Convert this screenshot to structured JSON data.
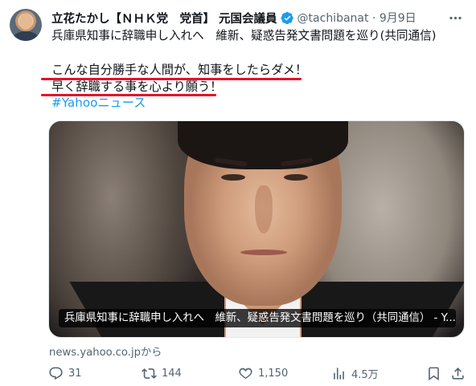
{
  "tweet": {
    "author_name": "立花たかし【ＮＨＫ党　党首】 元国会議員",
    "handle_time": "@tachibanat · 9月9日",
    "text_line1": "兵庫県知事に辞職申し入れへ　維新、疑惑告発文書問題を巡り(共同通信)",
    "text_line2": "こんな自分勝手な人間が、知事をしたらダメ！",
    "text_line3": "早く辞職する事を心より願う！",
    "hashtag": "#Yahooニュース"
  },
  "card": {
    "caption": "兵庫県知事に辞職申し入れへ　維新、疑惑告発文書問題を巡り（共同通信） - Y...",
    "source": "news.yahoo.co.jpから"
  },
  "actions": {
    "replies": "31",
    "reposts": "144",
    "likes": "1,150",
    "views": "4.5万"
  },
  "colors": {
    "link": "#1d9bf0",
    "secondary_text": "#536471",
    "annotation_red": "#e8102a",
    "verified_badge": "#1d9bf0"
  },
  "icons": [
    "verified-badge-icon",
    "more-icon",
    "reply-icon",
    "repost-icon",
    "like-icon",
    "views-icon",
    "bookmark-icon",
    "share-icon"
  ]
}
